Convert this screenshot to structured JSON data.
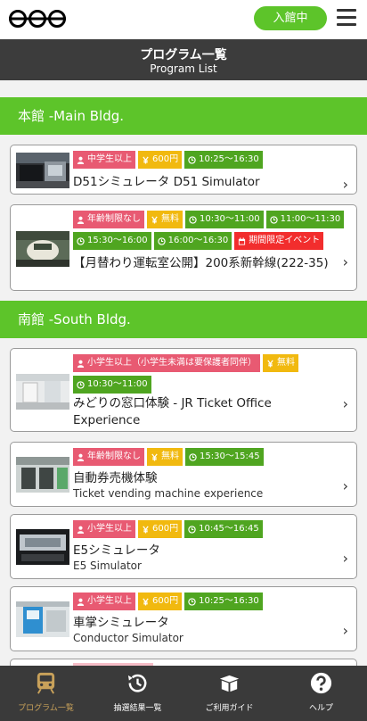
{
  "header": {
    "checkin_label": "入館中",
    "title_jp": "プログラム一覧",
    "title_en": "Program List"
  },
  "sections": [
    {
      "title": "本館 -Main Bldg."
    },
    {
      "title": "南館 -South Bldg."
    }
  ],
  "programs": [
    {
      "tags": [
        {
          "text": "中学生以上",
          "color": "#e85a72",
          "icon": "person-icon"
        },
        {
          "text": "600円",
          "color": "#f1b90f",
          "icon": "yen-icon"
        },
        {
          "text": "10:25〜16:30",
          "color": "#4fa520",
          "icon": "clock-icon"
        }
      ],
      "title": "D51シミュレータ D51 Simulator"
    },
    {
      "tags": [
        {
          "text": "年齢制限なし",
          "color": "#e85a72",
          "icon": "person-icon"
        },
        {
          "text": "無料",
          "color": "#f1b90f",
          "icon": "yen-icon"
        },
        {
          "text": "10:30〜11:00",
          "color": "#4fa520",
          "icon": "clock-icon"
        },
        {
          "text": "11:00〜11:30",
          "color": "#4fa520",
          "icon": "clock-icon"
        },
        {
          "text": "15:30〜16:00",
          "color": "#4fa520",
          "icon": "clock-icon"
        },
        {
          "text": "16:00〜16:30",
          "color": "#4fa520",
          "icon": "clock-icon"
        },
        {
          "text": "期間限定イベント",
          "color": "#f22d2d",
          "icon": "calendar-icon"
        }
      ],
      "title": "【月替わり運転室公開】200系新幹線(222-35)"
    },
    {
      "tags": [
        {
          "text": "小学生以上（小学生未満は要保護者同伴）",
          "color": "#e85a72",
          "icon": "person-icon"
        },
        {
          "text": "無料",
          "color": "#f1b90f",
          "icon": "yen-icon"
        },
        {
          "text": "10:30〜11:00",
          "color": "#4fa520",
          "icon": "clock-icon"
        }
      ],
      "title": "みどりの窓口体験 - JR Ticket Office Experience"
    },
    {
      "tags": [
        {
          "text": "年齢制限なし",
          "color": "#e85a72",
          "icon": "person-icon"
        },
        {
          "text": "無料",
          "color": "#f1b90f",
          "icon": "yen-icon"
        },
        {
          "text": "15:30〜15:45",
          "color": "#4fa520",
          "icon": "clock-icon"
        }
      ],
      "title": "自動券売機体験",
      "subtitle": "Ticket vending machine experience"
    },
    {
      "tags": [
        {
          "text": "小学生以上",
          "color": "#e85a72",
          "icon": "person-icon"
        },
        {
          "text": "600円",
          "color": "#f1b90f",
          "icon": "yen-icon"
        },
        {
          "text": "10:45〜16:45",
          "color": "#4fa520",
          "icon": "clock-icon"
        }
      ],
      "title": "E5シミュレータ",
      "subtitle": "E5 Simulator"
    },
    {
      "tags": [
        {
          "text": "小学生以上",
          "color": "#e85a72",
          "icon": "person-icon"
        },
        {
          "text": "600円",
          "color": "#f1b90f",
          "icon": "yen-icon"
        },
        {
          "text": "10:25〜16:30",
          "color": "#4fa520",
          "icon": "clock-icon"
        }
      ],
      "title": "車掌シミュレータ",
      "subtitle": "Conductor Simulator"
    }
  ],
  "nav": [
    {
      "label": "プログラム一覧",
      "icon": "train-icon",
      "active": true
    },
    {
      "label": "抽選結果一覧",
      "icon": "history-icon",
      "active": false
    },
    {
      "label": "ご利用ガイド",
      "icon": "box-icon",
      "active": false
    },
    {
      "label": "ヘルプ",
      "icon": "help-icon",
      "active": false
    }
  ]
}
